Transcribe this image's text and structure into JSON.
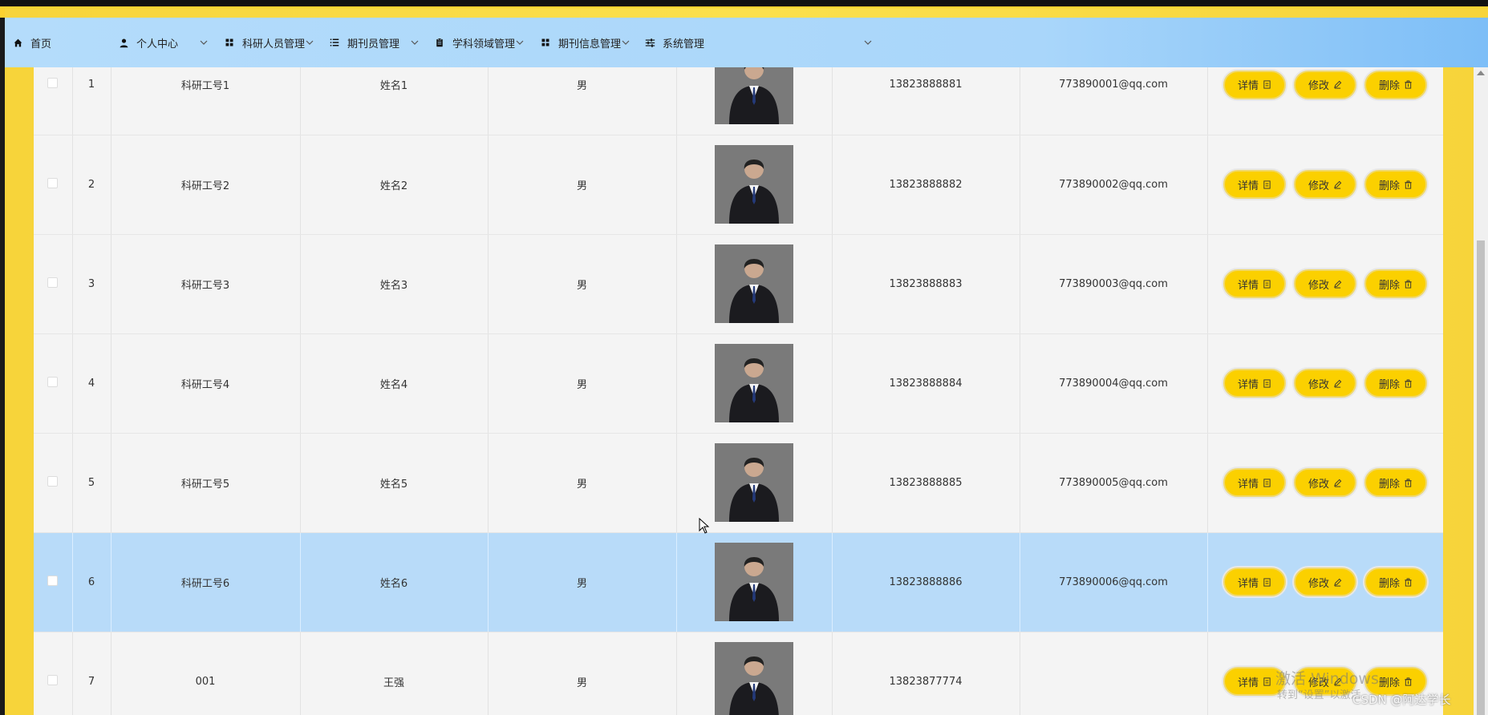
{
  "nav": {
    "items": [
      {
        "label": "首页",
        "icon": "home-icon",
        "has_dropdown": false
      },
      {
        "label": "个人中心",
        "icon": "user-icon",
        "has_dropdown": true
      },
      {
        "label": "科研人员管理",
        "icon": "grid-icon",
        "has_dropdown": true
      },
      {
        "label": "期刊员管理",
        "icon": "list-icon",
        "has_dropdown": true
      },
      {
        "label": "学科领域管理",
        "icon": "clipboard-icon",
        "has_dropdown": true
      },
      {
        "label": "期刊信息管理",
        "icon": "grid-icon",
        "has_dropdown": true
      },
      {
        "label": "系统管理",
        "icon": "sliders-icon",
        "has_dropdown": true
      }
    ]
  },
  "table": {
    "rows": [
      {
        "index": "1",
        "work_id": "科研工号1",
        "name": "姓名1",
        "gender": "男",
        "phone": "13823888881",
        "email": "773890001@qq.com",
        "selected": false
      },
      {
        "index": "2",
        "work_id": "科研工号2",
        "name": "姓名2",
        "gender": "男",
        "phone": "13823888882",
        "email": "773890002@qq.com",
        "selected": false
      },
      {
        "index": "3",
        "work_id": "科研工号3",
        "name": "姓名3",
        "gender": "男",
        "phone": "13823888883",
        "email": "773890003@qq.com",
        "selected": false
      },
      {
        "index": "4",
        "work_id": "科研工号4",
        "name": "姓名4",
        "gender": "男",
        "phone": "13823888884",
        "email": "773890004@qq.com",
        "selected": false
      },
      {
        "index": "5",
        "work_id": "科研工号5",
        "name": "姓名5",
        "gender": "男",
        "phone": "13823888885",
        "email": "773890005@qq.com",
        "selected": false
      },
      {
        "index": "6",
        "work_id": "科研工号6",
        "name": "姓名6",
        "gender": "男",
        "phone": "13823888886",
        "email": "773890006@qq.com",
        "selected": true
      },
      {
        "index": "7",
        "work_id": "001",
        "name": "王强",
        "gender": "男",
        "phone": "13823877774",
        "email": "",
        "selected": false
      }
    ],
    "actions": {
      "detail": "详情",
      "edit": "修改",
      "delete": "删除"
    }
  },
  "overlay": {
    "watermark_title": "激活 Windows",
    "watermark_sub": "转到“设置”以激活",
    "csdn": "CSDN @阿达学长"
  },
  "colors": {
    "accent_yellow": "#fbd000",
    "nav_blue": "#b4dcfb",
    "selected_row": "#b8dbf9"
  }
}
